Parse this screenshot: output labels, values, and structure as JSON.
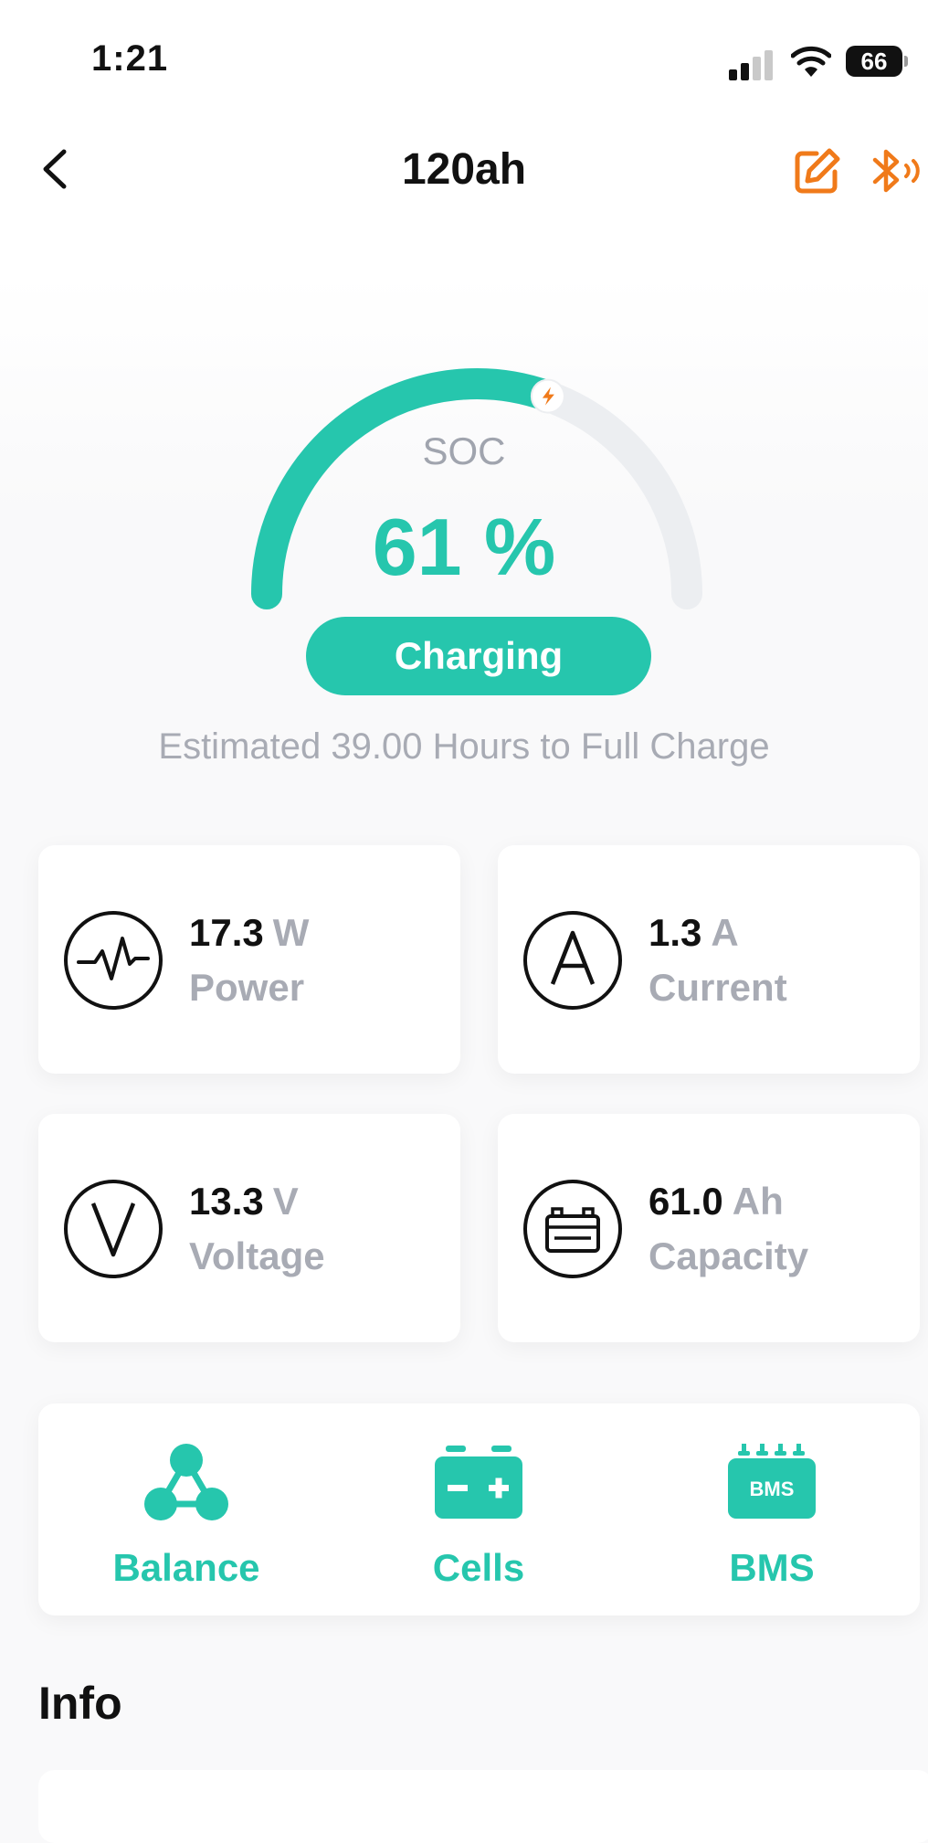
{
  "status_bar": {
    "time": "1:21",
    "battery": "66"
  },
  "header": {
    "title": "120ah"
  },
  "soc": {
    "label": "SOC",
    "value": "61 %",
    "fraction": 0.61,
    "state": "Charging"
  },
  "estimate": "Estimated 39.00 Hours to Full Charge",
  "stats": {
    "power": {
      "value": "17.3",
      "unit": "W",
      "label": "Power"
    },
    "current": {
      "value": "1.3",
      "unit": "A",
      "label": "Current"
    },
    "voltage": {
      "value": "13.3",
      "unit": "V",
      "label": "Voltage"
    },
    "capacity": {
      "value": "61.0",
      "unit": "Ah",
      "label": "Capacity"
    }
  },
  "actions": {
    "balance": "Balance",
    "cells": "Cells",
    "bms": "BMS",
    "bms_icon_text": "BMS"
  },
  "info": {
    "title": "Info"
  },
  "icons": {
    "back": "chevron-left-icon",
    "edit": "edit-icon",
    "bluetooth": "bluetooth-icon",
    "power": "pulse-icon",
    "current": "letter-a-icon",
    "voltage": "letter-v-icon",
    "capacity": "battery-icon",
    "balance": "balance-nodes-icon",
    "cells": "cell-battery-icon",
    "bms": "bms-icon"
  },
  "colors": {
    "accent": "#26c6ad",
    "orange": "#f07a1a",
    "muted": "#a8abb4"
  }
}
